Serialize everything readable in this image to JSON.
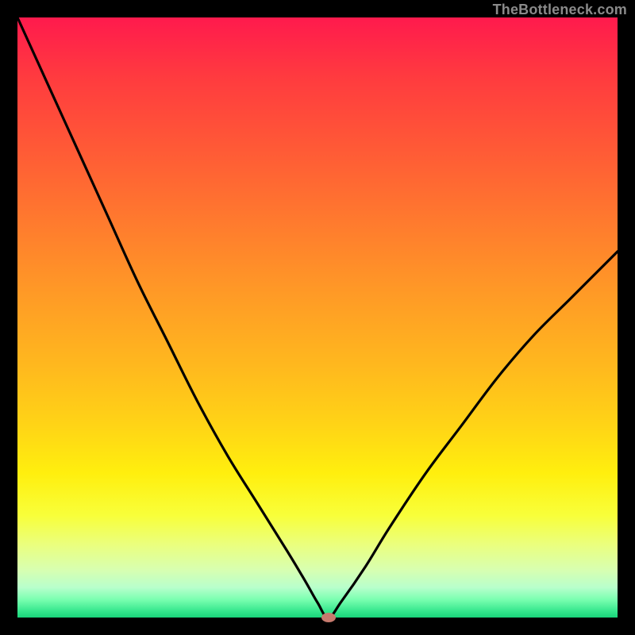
{
  "watermark": "TheBottleneck.com",
  "colors": {
    "frame": "#000000",
    "curve": "#000000",
    "marker": "#c77a6e",
    "gradient_top": "#ff1a4d",
    "gradient_bottom": "#19d47a"
  },
  "chart_data": {
    "type": "line",
    "title": "",
    "xlabel": "",
    "ylabel": "",
    "xlim": [
      0,
      100
    ],
    "ylim": [
      0,
      100
    ],
    "series": [
      {
        "name": "bottleneck-curve",
        "x": [
          0,
          5,
          10,
          15,
          20,
          25,
          30,
          35,
          40,
          45,
          48,
          50,
          51.8,
          54,
          58,
          62,
          68,
          74,
          80,
          86,
          92,
          100
        ],
        "values": [
          100,
          89,
          78,
          67,
          56,
          46,
          36,
          27,
          19,
          11,
          6,
          2.5,
          0,
          2.7,
          8.5,
          15,
          24,
          32,
          40,
          47,
          53,
          61
        ]
      }
    ],
    "marker": {
      "x": 51.8,
      "y": 0
    },
    "annotations": []
  }
}
